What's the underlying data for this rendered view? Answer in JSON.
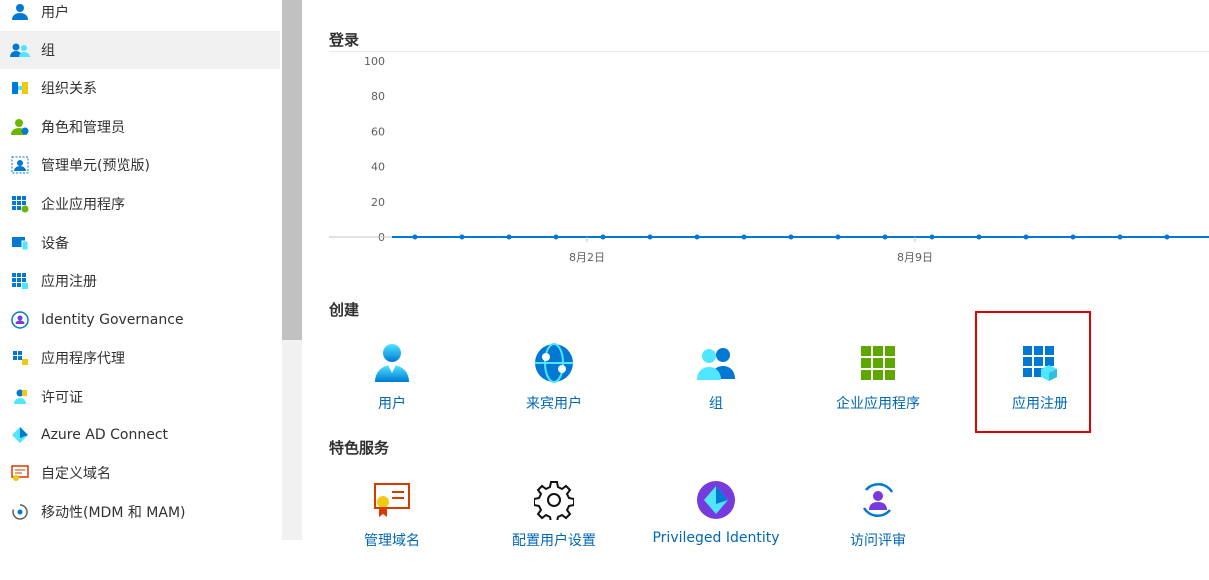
{
  "sidebar": {
    "items": [
      {
        "label": "用户",
        "icon": "user-icon"
      },
      {
        "label": "组",
        "icon": "group-icon",
        "selected": true
      },
      {
        "label": "组织关系",
        "icon": "org-relations-icon"
      },
      {
        "label": "角色和管理员",
        "icon": "roles-icon"
      },
      {
        "label": "管理单元(预览版)",
        "icon": "admin-units-icon"
      },
      {
        "label": "企业应用程序",
        "icon": "enterprise-apps-icon"
      },
      {
        "label": "设备",
        "icon": "devices-icon"
      },
      {
        "label": "应用注册",
        "icon": "app-registrations-icon"
      },
      {
        "label": "Identity Governance",
        "icon": "identity-governance-icon"
      },
      {
        "label": "应用程序代理",
        "icon": "app-proxy-icon"
      },
      {
        "label": "许可证",
        "icon": "licenses-icon"
      },
      {
        "label": "Azure AD Connect",
        "icon": "azure-ad-connect-icon"
      },
      {
        "label": "自定义域名",
        "icon": "custom-domain-icon"
      },
      {
        "label": "移动性(MDM 和 MAM)",
        "icon": "mobility-icon"
      }
    ]
  },
  "signin": {
    "title": "登录"
  },
  "chart_data": {
    "type": "line",
    "title": "登录",
    "xlabel": "",
    "ylabel": "",
    "ylim": [
      0,
      100
    ],
    "yticks": [
      "0",
      "20",
      "40",
      "60",
      "80",
      "100"
    ],
    "xticks": [
      "8月2日",
      "8月9日"
    ],
    "series": [
      {
        "values": [
          0,
          0,
          0,
          0,
          0,
          0,
          0,
          0,
          0,
          0,
          0,
          0,
          0,
          0,
          0,
          0,
          0,
          0
        ]
      }
    ],
    "grid": false,
    "color": "#0078d4"
  },
  "create": {
    "title": "创建",
    "tiles": [
      {
        "label": "用户",
        "icon": "user-icon"
      },
      {
        "label": "来宾用户",
        "icon": "guest-user-icon"
      },
      {
        "label": "组",
        "icon": "group-icon"
      },
      {
        "label": "企业应用程序",
        "icon": "enterprise-apps-icon"
      },
      {
        "label": "应用注册",
        "icon": "app-registrations-icon"
      }
    ]
  },
  "featured": {
    "title": "特色服务",
    "tiles": [
      {
        "label": "管理域名",
        "icon": "certificate-icon"
      },
      {
        "label": "配置用户设置",
        "icon": "gear-icon"
      },
      {
        "label": "Privileged Identity",
        "icon": "privileged-identity-icon"
      },
      {
        "label": "访问评审",
        "icon": "access-review-icon"
      }
    ]
  },
  "colors": {
    "link": "#0067b8",
    "accent": "#0078d4",
    "highlight": "#e00000",
    "selected_bg": "#f0f0f0"
  }
}
